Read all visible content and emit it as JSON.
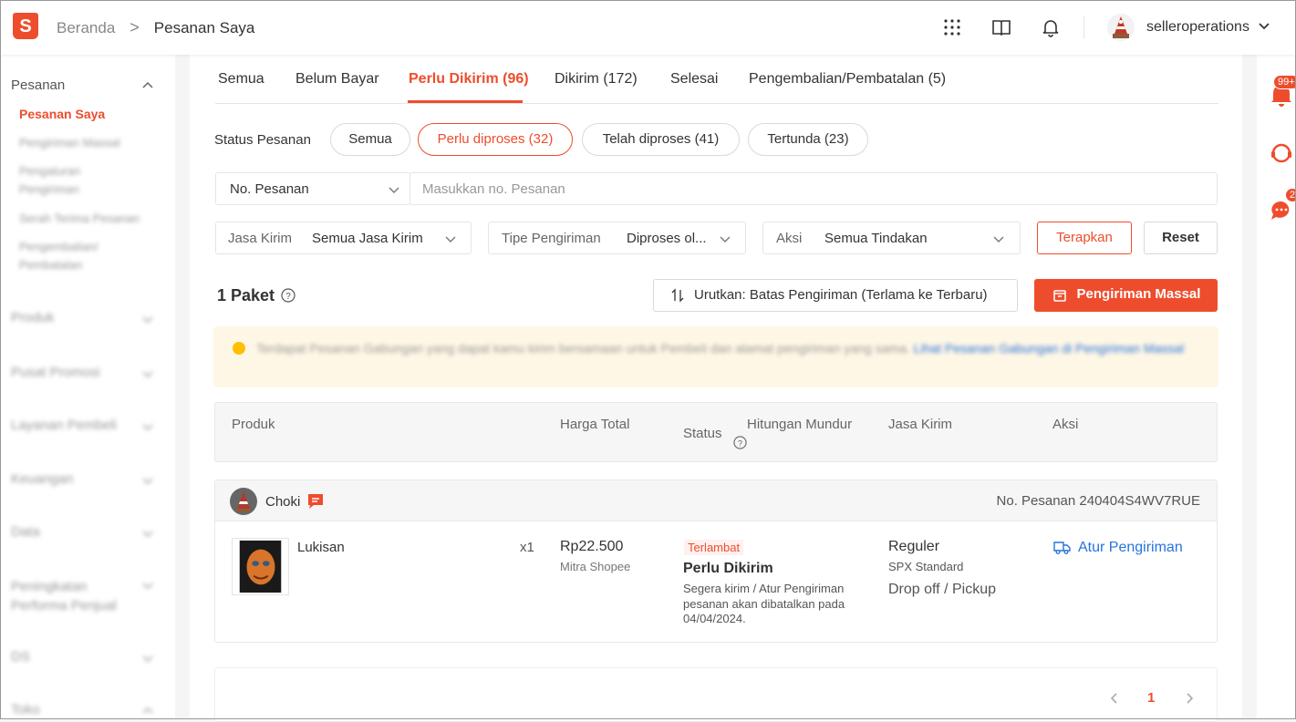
{
  "header": {
    "logo_letter": "S",
    "breadcrumb": {
      "home": "Beranda",
      "separator": ">",
      "current": "Pesanan Saya"
    },
    "username": "selleroperations",
    "icons": [
      "apps-grid-icon",
      "book-icon",
      "bell-icon",
      "chevron-down-icon"
    ]
  },
  "sidebar": {
    "section_title": "Pesanan",
    "active_item": "Pesanan Saya",
    "sub_items": [
      "Pengiriman Massal",
      "Pengaturan Pengiriman",
      "Serah Terima Pesanan",
      "Pengembalian/ Pembatalan"
    ],
    "sections": [
      "Produk",
      "Pusat Promosi",
      "Layanan Pembeli",
      "Keuangan",
      "Data",
      "Peningkatan Performa Penjual",
      "DS",
      "Toko"
    ]
  },
  "tabs": [
    {
      "label": "Semua"
    },
    {
      "label": "Belum Bayar"
    },
    {
      "label": "Perlu Dikirim (96)"
    },
    {
      "label": "Dikirim (172)"
    },
    {
      "label": "Selesai"
    },
    {
      "label": "Pengembalian/Pembatalan (5)"
    }
  ],
  "status_filter": {
    "label": "Status Pesanan",
    "pills": [
      "Semua",
      "Perlu diproses (32)",
      "Telah diproses (41)",
      "Tertunda (23)"
    ]
  },
  "search": {
    "field_select": "No. Pesanan",
    "placeholder": "Masukkan no. Pesanan"
  },
  "filters": {
    "jasa_kirim_label": "Jasa Kirim",
    "jasa_kirim_value": "Semua Jasa Kirim",
    "tipe_label": "Tipe Pengiriman",
    "tipe_value": "Diproses ol...",
    "aksi_label": "Aksi",
    "aksi_value": "Semua Tindakan",
    "apply": "Terapkan",
    "reset": "Reset"
  },
  "summary": {
    "count_label": "1 Paket",
    "sort_label": "Urutkan: Batas Pengiriman (Terlama ke Terbaru)",
    "mass_ship": "Pengiriman Massal"
  },
  "banner": {
    "text": "Terdapat Pesanan Gabungan yang dapat kamu kirim bersamaan untuk Pembeli dan alamat pengiriman yang sama.",
    "link": "Lihat Pesanan Gabungan di Pengiriman Massal"
  },
  "table_headers": {
    "produk": "Produk",
    "harga": "Harga Total",
    "status": "Status",
    "countdown": "Hitungan Mundur",
    "jasa": "Jasa Kirim",
    "aksi": "Aksi"
  },
  "order": {
    "buyer": "Choki",
    "order_no": "No. Pesanan 240404S4WV7RUE",
    "product_name": "Lukisan",
    "qty": "x1",
    "price": "Rp22.500",
    "price_note": "Mitra Shopee",
    "late_badge": "Terlambat",
    "status": "Perlu Dikirim",
    "status_note_1": "Segera kirim / Atur Pengiriman",
    "status_note_2": "pesanan akan dibatalkan pada",
    "status_note_3": "04/04/2024.",
    "shipping": "Reguler",
    "shipping_sub": "SPX Standard",
    "shipping_method": "Drop off / Pickup",
    "action": "Atur Pengiriman"
  },
  "pagination": {
    "current": "1"
  },
  "right_bar": {
    "notif_badge": "99+",
    "chat_badge": "2"
  },
  "colors": {
    "brand": "#ee4d2d",
    "link": "#2673dd",
    "banner_bg": "#fff7e6"
  }
}
